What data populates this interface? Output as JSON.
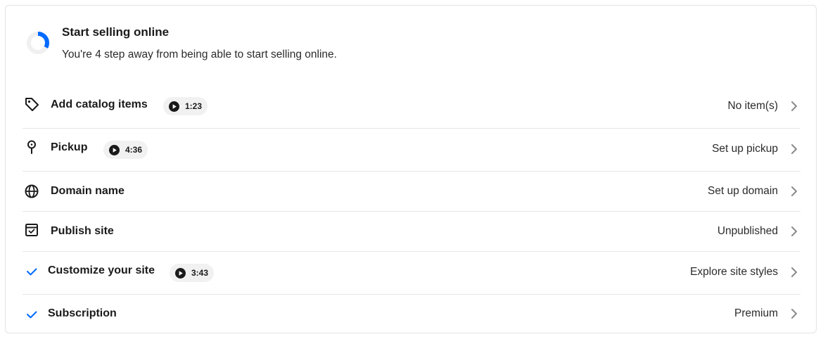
{
  "header": {
    "title": "Start selling online",
    "subtitle": "You're 4 step away from being able to start selling online.",
    "progress_fraction": 0.33,
    "progress_color": "#006aff",
    "track_color": "#f0f0f0"
  },
  "tasks": [
    {
      "label": "Add catalog items",
      "icon": "tag-icon",
      "video": "1:23",
      "status": "No item(s)"
    },
    {
      "label": "Pickup",
      "icon": "location-pin-icon",
      "video": "4:36",
      "status": "Set up pickup"
    },
    {
      "label": "Domain name",
      "icon": "globe-icon",
      "status": "Set up domain"
    },
    {
      "label": "Publish site",
      "icon": "publish-box-icon",
      "status": "Unpublished"
    },
    {
      "label": "Customize your site",
      "icon": "checkmark-icon",
      "video": "3:43",
      "status": "Explore site styles"
    },
    {
      "label": "Subscription",
      "icon": "checkmark-icon",
      "status": "Premium"
    }
  ],
  "colors": {
    "accent": "#006aff",
    "chip_bg": "#f1f1f1",
    "divider": "#e6e6e6",
    "chevron": "#8a8a8a"
  }
}
